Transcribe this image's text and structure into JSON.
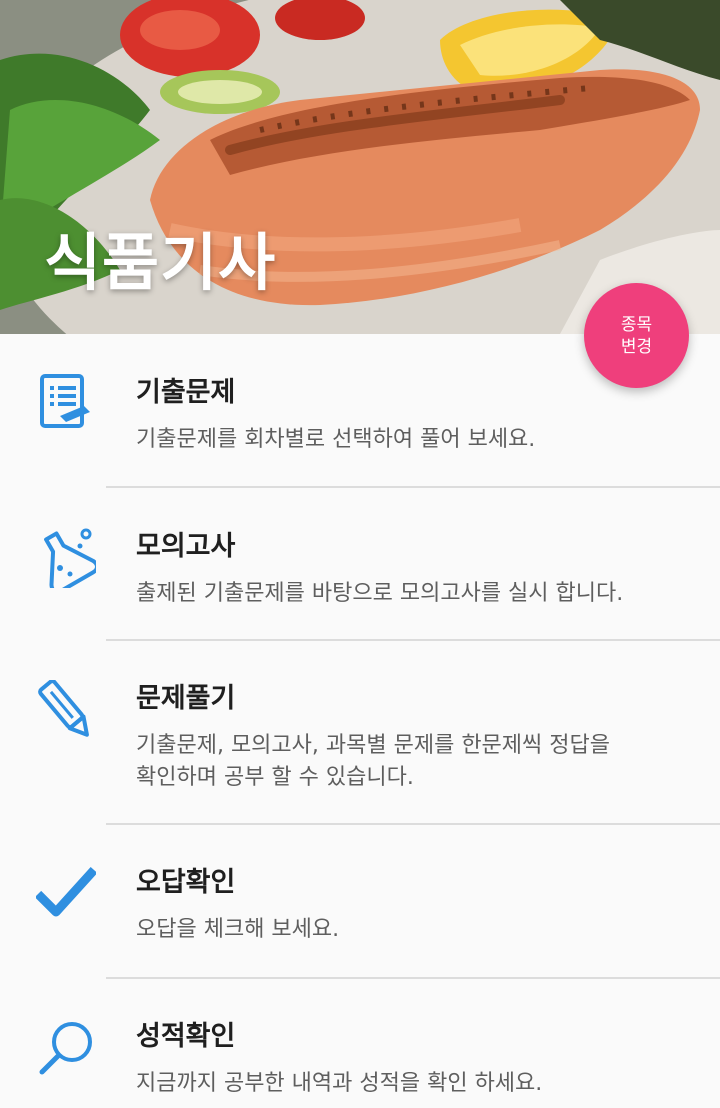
{
  "header": {
    "title": "식품기사",
    "change_button": [
      "종목",
      "변경"
    ],
    "image": "grilled-salmon-salad-photo"
  },
  "menu": [
    {
      "icon": "exam-book-icon",
      "title": "기출문제",
      "desc": "기출문제를 회차별로 선택하여 풀어 보세요."
    },
    {
      "icon": "flask-icon",
      "title": "모의고사",
      "desc": "출제된 기출문제를 바탕으로 모의고사를 실시 합니다."
    },
    {
      "icon": "pencil-icon",
      "title": "문제풀기",
      "desc": "기출문제, 모의고사, 과목별 문제를 한문제씩 정답을\n확인하며 공부 할 수 있습니다."
    },
    {
      "icon": "checkmark-icon",
      "title": "오답확인",
      "desc": "오답을 체크해 보세요."
    },
    {
      "icon": "magnifier-icon",
      "title": "성적확인",
      "desc": "지금까지 공부한 내역과 성적을 확인 하세요."
    }
  ],
  "colors": {
    "accent": "#ef3f7c",
    "icon": "#2f8fe0"
  }
}
